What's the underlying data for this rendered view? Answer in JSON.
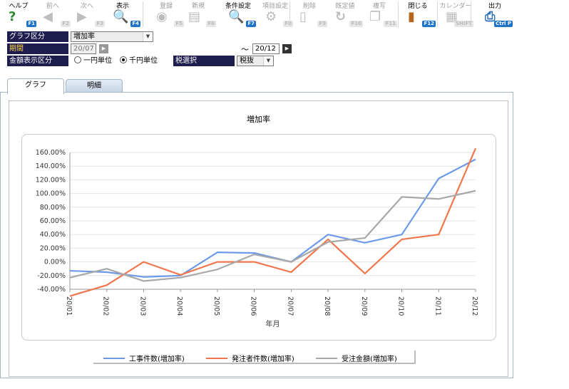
{
  "toolbar": {
    "buttons": [
      {
        "label": "ヘルプ",
        "key": "F1",
        "icon": "help-icon",
        "enabled": true
      },
      {
        "label": "前へ",
        "key": "F2",
        "icon": "arrow-left-icon",
        "enabled": false
      },
      {
        "label": "次へ",
        "key": "F3",
        "icon": "arrow-right-icon",
        "enabled": false
      },
      {
        "label": "表示",
        "key": "F4",
        "icon": "magnifier-icon",
        "enabled": true
      },
      {
        "label": "登録",
        "key": "F5",
        "icon": "register-icon",
        "enabled": false
      },
      {
        "label": "新規",
        "key": "F6",
        "icon": "new-document-icon",
        "enabled": false
      },
      {
        "label": "条件設定",
        "key": "F7",
        "icon": "condition-search-icon",
        "enabled": true
      },
      {
        "label": "項目設定",
        "key": "F8",
        "icon": "item-settings-icon",
        "enabled": false
      },
      {
        "label": "削除",
        "key": "F9",
        "icon": "trash-icon",
        "enabled": false
      },
      {
        "label": "既定値",
        "key": "F10",
        "icon": "refresh-icon",
        "enabled": false
      },
      {
        "label": "複写",
        "key": "F11",
        "icon": "copy-icon",
        "enabled": false
      },
      {
        "label": "閉じる",
        "key": "F12",
        "icon": "exit-door-icon",
        "enabled": true
      },
      {
        "label": "カレンダー",
        "key": "SHIFT",
        "icon": "calendar-icon",
        "enabled": false
      },
      {
        "label": "出力",
        "key": "Ctrl P",
        "icon": "print-search-icon",
        "enabled": true
      }
    ]
  },
  "filters": {
    "graph_type_label": "グラフ区分",
    "graph_type_value": "増加率",
    "period_label": "期間",
    "period_from": "20/07",
    "period_sep": "～",
    "period_to": "20/12",
    "amount_label": "金額表示区分",
    "unit_yen": "一円単位",
    "unit_thousand": "千円単位",
    "tax_label": "税選択",
    "tax_value": "税抜"
  },
  "tabs": [
    {
      "label": "グラフ",
      "active": true
    },
    {
      "label": "明細",
      "active": false
    }
  ],
  "chart_data": {
    "type": "line",
    "title": "増加率",
    "xlabel": "年月",
    "ylabel": "",
    "categories": [
      "20/01",
      "20/02",
      "20/03",
      "20/04",
      "20/05",
      "20/06",
      "20/07",
      "20/08",
      "20/09",
      "20/10",
      "20/11",
      "20/12"
    ],
    "ylim": [
      -40,
      160
    ],
    "yticks": [
      -40,
      -20,
      0,
      20,
      40,
      60,
      80,
      100,
      120,
      140,
      160
    ],
    "ytick_labels": [
      "-40.00%",
      "-20.00%",
      "0.00%",
      "20.00%",
      "40.00%",
      "60.00%",
      "80.00%",
      "100.00%",
      "120.00%",
      "140.00%",
      "160.00%"
    ],
    "grid": true,
    "legend_position": "bottom",
    "series": [
      {
        "name": "工事件数(増加率)",
        "color": "#6c9ae8",
        "values": [
          -13,
          -15,
          -22,
          -20,
          14,
          13,
          0,
          40,
          28,
          40,
          122,
          150
        ]
      },
      {
        "name": "発注者件数(増加率)",
        "color": "#f0774d",
        "values": [
          -50,
          -34,
          0,
          -19,
          0,
          0,
          -15,
          33,
          -17,
          33,
          40,
          166
        ]
      },
      {
        "name": "受注金額(増加率)",
        "color": "#a8a8a8",
        "values": [
          -23,
          -10,
          -28,
          -23,
          -11,
          11,
          0,
          29,
          35,
          95,
          92,
          104
        ]
      }
    ]
  }
}
